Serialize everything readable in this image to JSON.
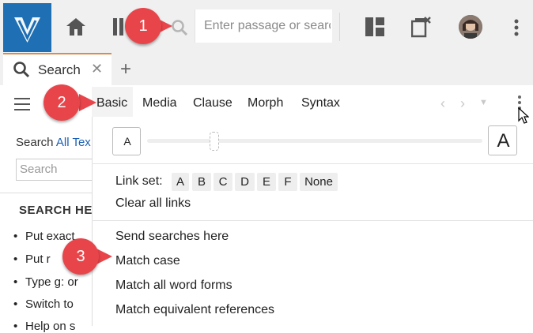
{
  "toolbar": {
    "search_placeholder": "Enter passage or search",
    "icons": [
      "logo-icon",
      "home-icon",
      "library-icon",
      "search-icon",
      "layout-icon",
      "close-panels-icon",
      "avatar",
      "more-vertical-icon"
    ]
  },
  "tabs": [
    {
      "label": "Search",
      "icon": "search-icon"
    }
  ],
  "left_panel": {
    "search_prefix": "Search",
    "search_scope": "All Tex",
    "search_placeholder": "Search",
    "help_heading": "SEARCH HE",
    "help_items": [
      "Put exact",
      "Put r",
      "Type g: or",
      "Switch to",
      "Help on s"
    ]
  },
  "menu": {
    "tabs": [
      "Basic",
      "Media",
      "Clause",
      "Morph",
      "Syntax"
    ],
    "font_small": "A",
    "font_large": "A",
    "link_set_label": "Link set:",
    "link_options": [
      "A",
      "B",
      "C",
      "D",
      "E",
      "F",
      "None"
    ],
    "clear_links": "Clear all links",
    "items": [
      "Send searches here",
      "Match case",
      "Match all word forms",
      "Match equivalent references"
    ]
  },
  "badges": [
    "1",
    "2",
    "3"
  ],
  "colors": {
    "brand_blue": "#1e6fb3",
    "accent_orange": "#e0894a",
    "badge_red": "#e8454a",
    "link_blue": "#1a5fb4"
  }
}
